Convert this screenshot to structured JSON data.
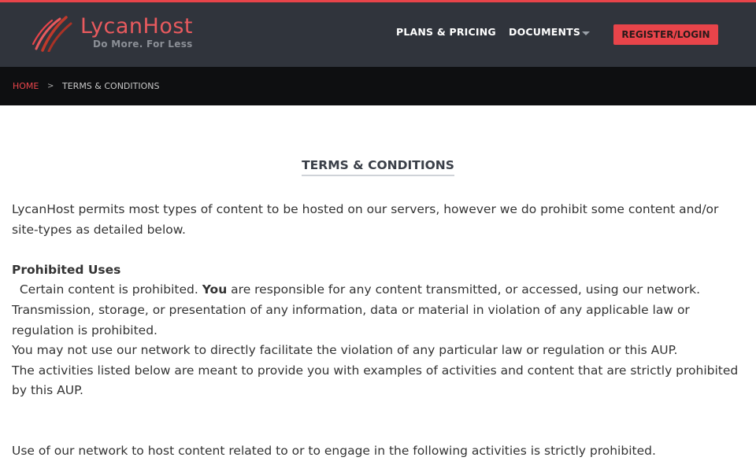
{
  "header": {
    "logo_name": "LycanHost",
    "logo_tagline": "Do More. For Less",
    "nav": {
      "plans_pricing": "PLANS & PRICING",
      "documents": "DOCUMENTS",
      "register_login": "REGISTER/LOGIN"
    }
  },
  "breadcrumb": {
    "home": "HOME",
    "separator": ">",
    "current": "TERMS & CONDITIONS"
  },
  "main": {
    "title": "TERMS & CONDITIONS",
    "intro": "LycanHost permits most types of content to be hosted on our servers, however we do prohibit some content and/or site-types as detailed below.",
    "prohibited_heading": "Prohibited Uses",
    "line1_start": "Certain content is prohibited. ",
    "line1_bold": "You",
    "line1_end": " are responsible for any content transmitted, or accessed, using our network.",
    "line2": "Transmission, storage, or presentation of any information, data or material in violation of any applicable law or regulation is prohibited.",
    "line3": "You may not use our network to directly facilitate the violation of any particular law or regulation or this AUP.",
    "line4": "The activities listed below are meant to provide you with examples of activities and content that are strictly prohibited by this AUP.",
    "line5": "Use of our network to host content related to or to engage in the following activities is strictly prohibited."
  },
  "colors": {
    "accent": "#e8444a",
    "header_bg": "#30343c",
    "breadcrumb_bg": "#0e0f11"
  }
}
